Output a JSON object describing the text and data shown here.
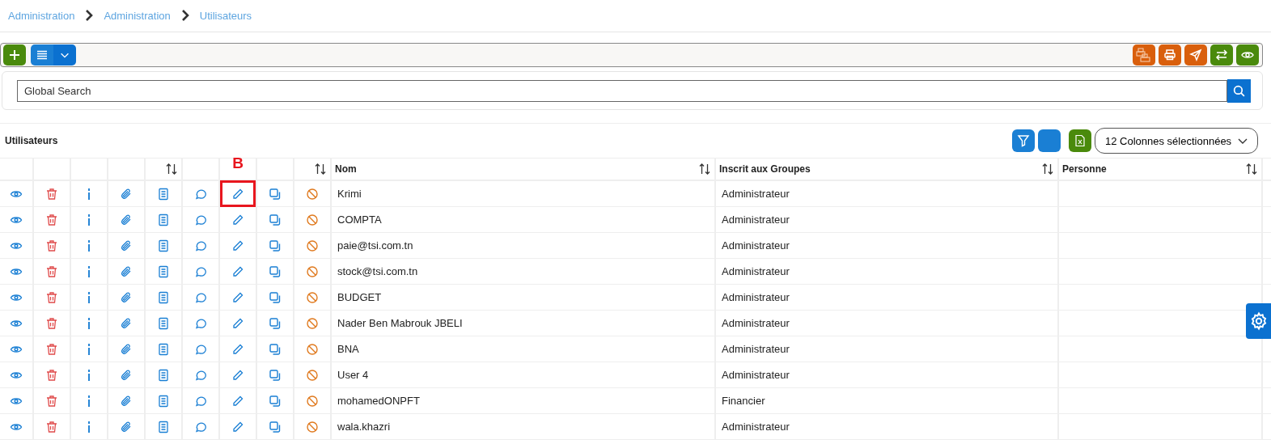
{
  "breadcrumb": [
    "Administration",
    "Administration",
    "Utilisateurs"
  ],
  "search": {
    "placeholder": "Global Search"
  },
  "table": {
    "title": "Utilisateurs",
    "column_select": "12 Colonnes sélectionnées",
    "columns": [
      {
        "kind": "view",
        "sortable": false
      },
      {
        "kind": "delete",
        "sortable": false
      },
      {
        "kind": "info",
        "sortable": false
      },
      {
        "kind": "attach",
        "sortable": false
      },
      {
        "kind": "doc",
        "sortable": true
      },
      {
        "kind": "comment",
        "sortable": false
      },
      {
        "kind": "edit",
        "sortable": false
      },
      {
        "kind": "copy",
        "sortable": false
      },
      {
        "kind": "block",
        "sortable": true
      },
      {
        "kind": "text",
        "label": "Nom",
        "sortable": true
      },
      {
        "kind": "text",
        "label": "Inscrit aux Groupes",
        "sortable": true
      },
      {
        "kind": "text",
        "label": "Personne",
        "sortable": true
      }
    ],
    "rows": [
      {
        "nom": "Krimi",
        "groupe": "Administrateur",
        "highlighted": true
      },
      {
        "nom": "COMPTA",
        "groupe": "Administrateur",
        "highlighted": false
      },
      {
        "nom": "paie@tsi.com.tn",
        "groupe": "Administrateur",
        "highlighted": false
      },
      {
        "nom": "stock@tsi.com.tn",
        "groupe": "Administrateur",
        "highlighted": false
      },
      {
        "nom": "BUDGET",
        "groupe": "Administrateur",
        "highlighted": false
      },
      {
        "nom": "Nader Ben Mabrouk JBELI",
        "groupe": "Administrateur",
        "highlighted": false
      },
      {
        "nom": "BNA",
        "groupe": "Administrateur",
        "highlighted": false
      },
      {
        "nom": "User 4",
        "groupe": "Administrateur",
        "highlighted": false
      },
      {
        "nom": "mohamedONPFT",
        "groupe": "Financier",
        "highlighted": false
      },
      {
        "nom": "wala.khazri",
        "groupe": "Administrateur",
        "highlighted": false
      }
    ]
  },
  "annotation": {
    "label": "B"
  }
}
